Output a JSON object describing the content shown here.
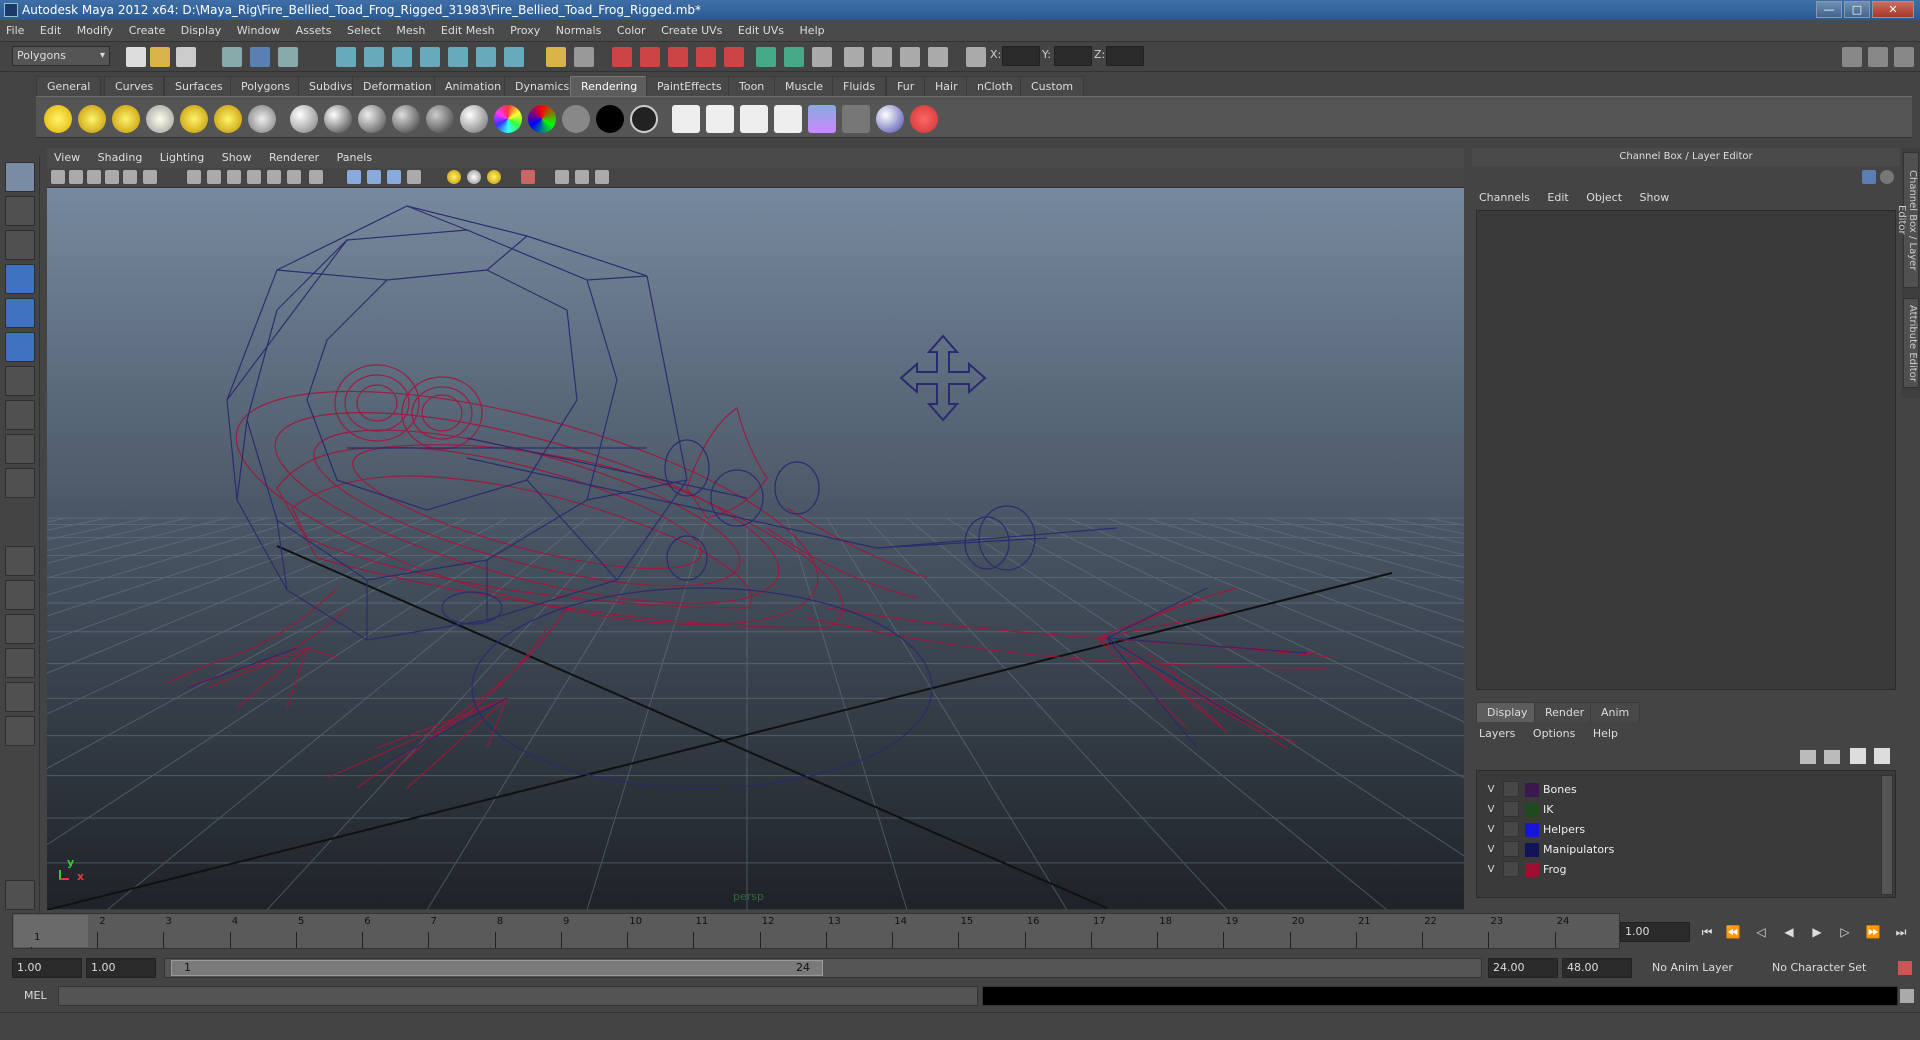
{
  "window": {
    "title": "Autodesk Maya 2012 x64: D:\\Maya_Rig\\Fire_Bellied_Toad_Frog_Rigged_31983\\Fire_Bellied_Toad_Frog_Rigged.mb*",
    "min": "—",
    "max": "□",
    "close": "✕"
  },
  "menubar": [
    "File",
    "Edit",
    "Modify",
    "Create",
    "Display",
    "Window",
    "Assets",
    "Select",
    "Mesh",
    "Edit Mesh",
    "Proxy",
    "Normals",
    "Color",
    "Create UVs",
    "Edit UVs",
    "Help"
  ],
  "statusline": {
    "mode": "Polygons",
    "x_label": "X:",
    "y_label": "Y:",
    "z_label": "Z:"
  },
  "shelf": {
    "tabs": [
      "General",
      "Curves",
      "Surfaces",
      "Polygons",
      "Subdivs",
      "Deformation",
      "Animation",
      "Dynamics",
      "Rendering",
      "PaintEffects",
      "Toon",
      "Muscle",
      "Fluids",
      "Fur",
      "Hair",
      "nCloth",
      "Custom"
    ],
    "active_tab": "Rendering"
  },
  "viewport": {
    "menu": [
      "View",
      "Shading",
      "Lighting",
      "Show",
      "Renderer",
      "Panels"
    ],
    "camera_label": "persp",
    "axis_y": "y",
    "axis_x": "x",
    "colors": {
      "wire_red": "#a0163c",
      "wire_blue": "#2a2a6e",
      "grid": "#6b7a88"
    }
  },
  "right_panel": {
    "title": "Channel Box / Layer Editor",
    "menu": [
      "Channels",
      "Edit",
      "Object",
      "Show"
    ],
    "layer_tabs": [
      "Display",
      "Render",
      "Anim"
    ],
    "active_layer_tab": "Display",
    "layer_menu": [
      "Layers",
      "Options",
      "Help"
    ],
    "layers": [
      {
        "vis": "V",
        "name": "Bones",
        "color": "#3a1a4e"
      },
      {
        "vis": "V",
        "name": "IK",
        "color": "#1f4a1f"
      },
      {
        "vis": "V",
        "name": "Helpers",
        "color": "#1616d9"
      },
      {
        "vis": "V",
        "name": "Manipulators",
        "color": "#13135a"
      },
      {
        "vis": "V",
        "name": "Frog",
        "color": "#9e1030"
      }
    ],
    "side_tabs": [
      "Channel Box / Layer Editor",
      "Attribute Editor"
    ]
  },
  "timeslider": {
    "numbers": [
      "1",
      "2",
      "3",
      "4",
      "5",
      "6",
      "7",
      "8",
      "9",
      "10",
      "11",
      "12",
      "13",
      "14",
      "15",
      "16",
      "17",
      "18",
      "19",
      "20",
      "21",
      "22",
      "23",
      "24"
    ],
    "current_marker": "1",
    "current_frame": "1.00"
  },
  "range": {
    "start": "1.00",
    "playback_start": "1.00",
    "thumb_start": "1",
    "thumb_end": "24",
    "playback_end": "24.00",
    "end": "48.00",
    "anim_layer": "No Anim Layer",
    "char_set": "No Character Set"
  },
  "command": {
    "label": "MEL"
  }
}
